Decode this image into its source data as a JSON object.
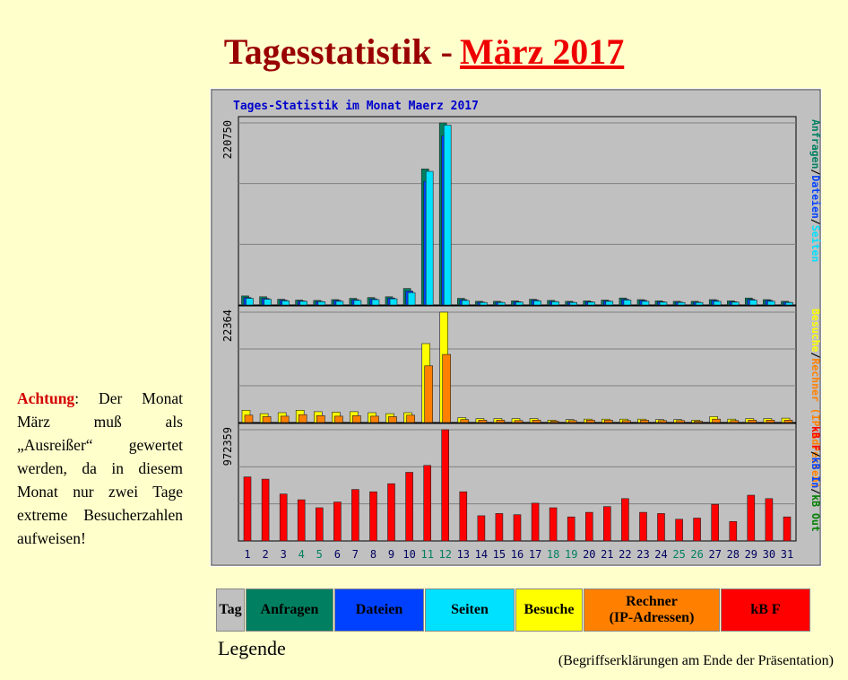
{
  "page": {
    "title_main": "Tagesstatistik",
    "title_sep": "-",
    "title_month": "März 2017",
    "note_warning": "Achtung",
    "note_text": ": Der Monat März muß als „Ausreißer“ gewertet werden, da in diesem Monat nur zwei Tage extreme Besucherzahlen aufweisen!",
    "legend_label": "Legende",
    "footnote": "(Begriffserklärungen am Ende der Präsentation)"
  },
  "legend": [
    {
      "label": "Tag",
      "color": "#c0c0c0",
      "text_color": "#000000"
    },
    {
      "label": "Anfragen",
      "color": "#008060",
      "text_color": "#000000"
    },
    {
      "label": "Dateien",
      "color": "#0040ff",
      "text_color": "#000000"
    },
    {
      "label": "Seiten",
      "color": "#00e0ff",
      "text_color": "#000000"
    },
    {
      "label": "Besuche",
      "color": "#ffff00",
      "text_color": "#000000"
    },
    {
      "label": "Rechner\n(IP-Adressen)",
      "color": "#ff8000",
      "text_color": "#000000"
    },
    {
      "label": "kB F",
      "color": "#ff0000",
      "text_color": "#000000"
    }
  ],
  "chart_data": {
    "type": "bar",
    "title": "Tages-Statistik im Monat Maerz 2017",
    "categories": [
      "1",
      "2",
      "3",
      "4",
      "5",
      "6",
      "7",
      "8",
      "9",
      "10",
      "11",
      "12",
      "13",
      "14",
      "15",
      "16",
      "17",
      "18",
      "19",
      "20",
      "21",
      "22",
      "23",
      "24",
      "25",
      "26",
      "27",
      "28",
      "29",
      "30",
      "31"
    ],
    "weekend_days": [
      "4",
      "5",
      "11",
      "12",
      "18",
      "19",
      "25",
      "26"
    ],
    "colors": {
      "anfragen": "#008060",
      "dateien": "#0040ff",
      "seiten": "#00e0ff",
      "besuche": "#ffff00",
      "rechner": "#ff8000",
      "kbf": "#ff0000",
      "kbin": "#0040ff",
      "kbout": "#008000",
      "title": "#0000cc",
      "weekend_label": "#008060",
      "weekday_label": "#000060"
    },
    "panels": [
      {
        "name": "hits",
        "ymax": 220750,
        "ymax_label": "220750",
        "side_label": [
          {
            "text": "Anfragen",
            "color": "#008060"
          },
          {
            "text": "/",
            "color": "#000000"
          },
          {
            "text": "Dateien",
            "color": "#0040ff"
          },
          {
            "text": "/",
            "color": "#000000"
          },
          {
            "text": "Seiten",
            "color": "#00e0ff"
          }
        ],
        "series": [
          {
            "key": "anfragen",
            "values": [
              11000,
              10000,
              7000,
              6000,
              5500,
              6500,
              8000,
              9000,
              10000,
              20000,
              165000,
              220750,
              8000,
              4500,
              4500,
              5000,
              7000,
              5500,
              4500,
              5000,
              6000,
              8500,
              6500,
              5000,
              4500,
              4500,
              6500,
              5000,
              8500,
              6500,
              4500
            ]
          },
          {
            "key": "dateien",
            "values": [
              9000,
              8000,
              6000,
              5000,
              4500,
              5500,
              6500,
              7500,
              8500,
              17000,
              150000,
              205000,
              6500,
              3500,
              3500,
              4000,
              6000,
              4500,
              3500,
              4000,
              5000,
              7000,
              5500,
              4000,
              3500,
              3500,
              5500,
              4000,
              7000,
              5500,
              3500
            ]
          },
          {
            "key": "seiten",
            "values": [
              8000,
              7000,
              5000,
              4500,
              4000,
              4500,
              5500,
              6500,
              7500,
              15000,
              162000,
              218000,
              5500,
              3000,
              3000,
              3500,
              5000,
              4000,
              3000,
              3500,
              4500,
              6000,
              4500,
              3500,
              3000,
              3000,
              4500,
              3500,
              6000,
              4500,
              3000
            ]
          }
        ]
      },
      {
        "name": "visits",
        "ymax": 22364,
        "ymax_label": "22364",
        "side_label": [
          {
            "text": "Besuche",
            "color": "#ffff00"
          },
          {
            "text": "/",
            "color": "#000000"
          },
          {
            "text": "Rechner (IP-Adressen)",
            "color": "#ff8000"
          }
        ],
        "series": [
          {
            "key": "besuche",
            "values": [
              2500,
              1800,
              2000,
              2500,
              2200,
              2100,
              2200,
              2000,
              1800,
              2000,
              16000,
              22364,
              1000,
              800,
              800,
              800,
              800,
              500,
              600,
              700,
              700,
              700,
              700,
              600,
              600,
              500,
              1200,
              700,
              800,
              800,
              900
            ]
          },
          {
            "key": "rechner",
            "values": [
              1500,
              1200,
              1300,
              1600,
              1400,
              1300,
              1400,
              1300,
              1200,
              1500,
              11500,
              13800,
              600,
              500,
              500,
              400,
              500,
              300,
              400,
              500,
              500,
              400,
              500,
              400,
              400,
              300,
              700,
              400,
              500,
              500,
              500
            ]
          }
        ]
      },
      {
        "name": "kb",
        "ymax": 972359,
        "ymax_label": "972359",
        "side_label": [
          {
            "text": "kB F",
            "color": "#ff0000"
          },
          {
            "text": "/",
            "color": "#000000"
          },
          {
            "text": "kB In",
            "color": "#0040ff"
          },
          {
            "text": "/",
            "color": "#000000"
          },
          {
            "text": "kB Out",
            "color": "#008000"
          }
        ],
        "series": [
          {
            "key": "kbf",
            "values": [
              560000,
              540000,
              410000,
              360000,
              290000,
              340000,
              450000,
              430000,
              500000,
              600000,
              660000,
              972359,
              430000,
              220000,
              240000,
              230000,
              330000,
              290000,
              210000,
              250000,
              300000,
              370000,
              250000,
              240000,
              190000,
              200000,
              320000,
              170000,
              400000,
              370000,
              210000
            ]
          }
        ]
      }
    ]
  }
}
